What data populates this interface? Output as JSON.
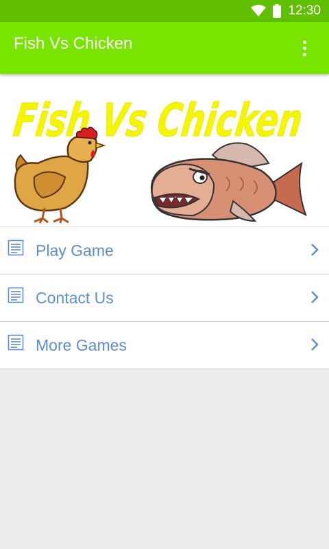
{
  "status_bar": {
    "time": "12:30",
    "icons": [
      "wifi-icon",
      "battery-icon"
    ]
  },
  "app_bar": {
    "title": "Fish Vs Chicken",
    "overflow_icon": "more-vert-icon",
    "color": "#78e400"
  },
  "banner": {
    "title": "Fish Vs Chicken",
    "title_color": "#f5f500"
  },
  "menu": {
    "items": [
      {
        "label": "Play Game",
        "icon": "list-icon"
      },
      {
        "label": "Contact Us",
        "icon": "list-icon"
      },
      {
        "label": "More Games",
        "icon": "list-icon"
      }
    ],
    "label_color": "#5b8ed1"
  }
}
